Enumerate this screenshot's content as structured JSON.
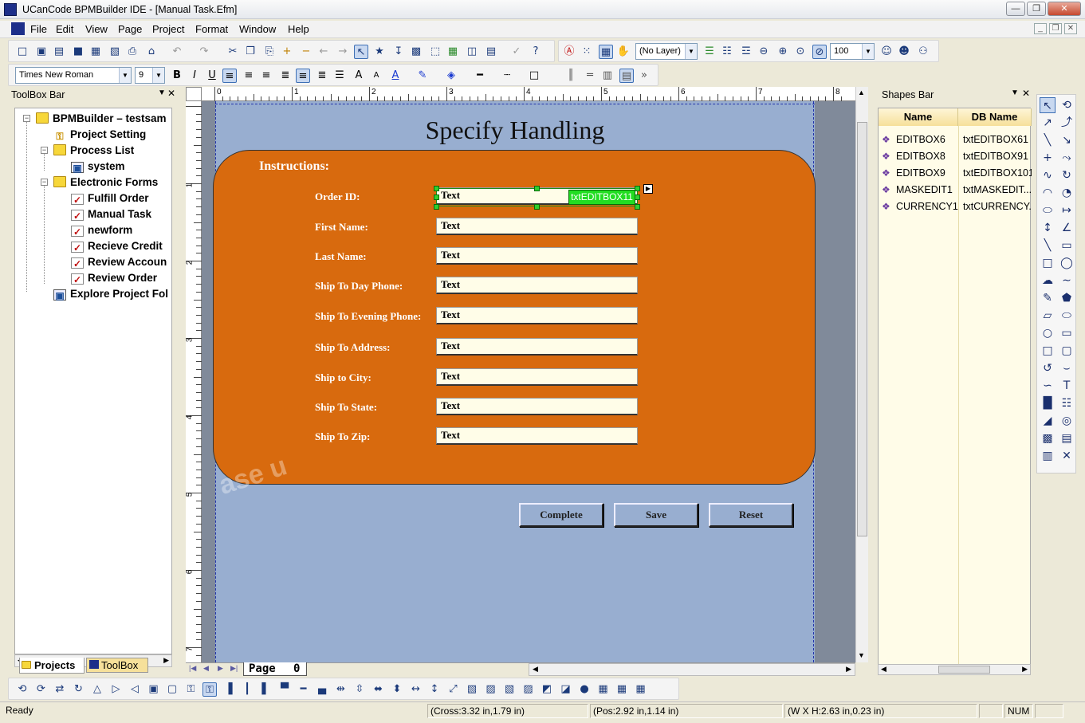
{
  "window": {
    "title": "UCanCode BPMBuilder IDE - [Manual Task.Efm]",
    "controls": [
      "—",
      "❐",
      "✕"
    ]
  },
  "menu": [
    "File",
    "Edit",
    "View",
    "Page",
    "Project",
    "Format",
    "Window",
    "Help"
  ],
  "toolbar": {
    "layer_combo": "(No Layer)",
    "zoom_value": "100",
    "font_name": "Times New Roman",
    "font_size": "9"
  },
  "toolbox": {
    "title": "ToolBox Bar",
    "tree": [
      {
        "label": "BPMBuilder – testsam",
        "icon": "folder-icon",
        "level": 0
      },
      {
        "label": "Project Setting",
        "icon": "key-icon",
        "level": 1
      },
      {
        "label": "Process List",
        "icon": "folder-icon",
        "level": 1
      },
      {
        "label": "system",
        "icon": "process-icon",
        "level": 2
      },
      {
        "label": "Electronic Forms",
        "icon": "folder-icon",
        "level": 1
      },
      {
        "label": "Fulfill Order",
        "icon": "form-icon",
        "level": 2
      },
      {
        "label": "Manual Task",
        "icon": "form-icon",
        "level": 2
      },
      {
        "label": "newform",
        "icon": "form-icon",
        "level": 2
      },
      {
        "label": "Recieve Credit",
        "icon": "form-icon",
        "level": 2
      },
      {
        "label": "Review Accoun",
        "icon": "form-icon",
        "level": 2
      },
      {
        "label": "Review Order",
        "icon": "form-icon",
        "level": 2
      },
      {
        "label": "Explore Project Fol",
        "icon": "explore-icon",
        "level": 1
      }
    ],
    "tabs": [
      "Projects",
      "ToolBox"
    ]
  },
  "form": {
    "title": "Specify Handling",
    "instructions": "Instructions:",
    "fields": [
      {
        "label": "Order ID:",
        "value": "Text"
      },
      {
        "label": "First Name:",
        "value": "Text"
      },
      {
        "label": "Last Name:",
        "value": "Text"
      },
      {
        "label": "Ship To Day Phone:",
        "value": "Text"
      },
      {
        "label": "Ship To Evening Phone:",
        "value": "Text"
      },
      {
        "label": "Ship To Address:",
        "value": "Text"
      },
      {
        "label": "Ship to City:",
        "value": "Text"
      },
      {
        "label": "Ship To State:",
        "value": "Text"
      },
      {
        "label": "Ship To Zip:",
        "value": "Text"
      }
    ],
    "selected_tag": "txtEDITBOX11",
    "buttons": [
      "Complete",
      "Save",
      "Reset"
    ],
    "watermark": "ase u",
    "page_tab": "Page",
    "page_num": "0"
  },
  "ruler": {
    "h_ticks": [
      "0",
      "1",
      "2",
      "3",
      "4",
      "5",
      "6",
      "7",
      "8"
    ],
    "v_ticks": [
      "1",
      "2",
      "3",
      "4",
      "5",
      "6",
      "7"
    ]
  },
  "shapes": {
    "title": "Shapes Bar",
    "headers": [
      "Name",
      "DB Name"
    ],
    "rows": [
      {
        "name": "EDITBOX6",
        "db": "txtEDITBOX61"
      },
      {
        "name": "EDITBOX8",
        "db": "txtEDITBOX91"
      },
      {
        "name": "EDITBOX9",
        "db": "txtEDITBOX101"
      },
      {
        "name": "MASKEDIT1",
        "db": "txtMASKEDIT..."
      },
      {
        "name": "CURRENCY1",
        "db": "txtCURRENCY..."
      }
    ]
  },
  "status": {
    "ready": "Ready",
    "cross": "(Cross:3.32 in,1.79 in)",
    "pos": "(Pos:2.92 in,1.14 in)",
    "size": "(W X H:2.63 in,0.23 in)",
    "num": "NUM"
  },
  "colors": {
    "form_bg": "#98aed0",
    "panel_orange": "#d86a0e",
    "selection_tag": "#22dd22"
  }
}
